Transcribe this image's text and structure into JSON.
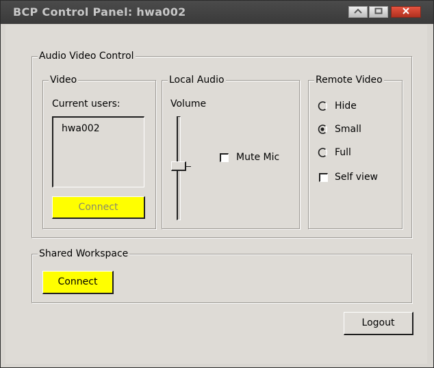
{
  "window": {
    "title": "BCP Control Panel: hwa002"
  },
  "audio_video_control": {
    "legend": "Audio Video Control",
    "video": {
      "legend": "Video",
      "current_users_label": "Current users:",
      "users": [
        "hwa002"
      ],
      "connect_label": "Connect"
    },
    "local_audio": {
      "legend": "Local Audio",
      "volume_label": "Volume",
      "volume_level": 0.5,
      "mute_mic_label": "Mute Mic",
      "mute_mic_checked": false
    },
    "remote_video": {
      "legend": "Remote Video",
      "options": [
        "Hide",
        "Small",
        "Full"
      ],
      "selected": "Small",
      "self_view_label": "Self view",
      "self_view_checked": false
    }
  },
  "shared_workspace": {
    "legend": "Shared Workspace",
    "connect_label": "Connect"
  },
  "logout_label": "Logout",
  "colors": {
    "accent_button": "#ffff00",
    "titlebar": "#3f3f3f",
    "window_bg": "#dedbd6"
  }
}
